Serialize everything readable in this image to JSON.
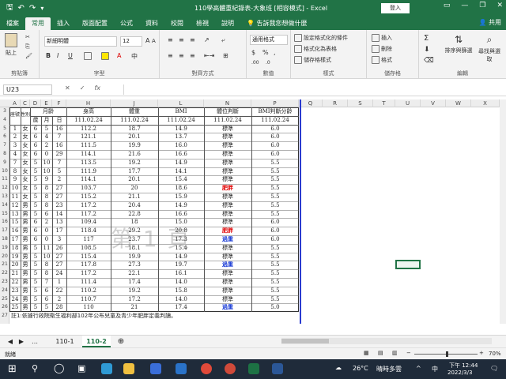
{
  "window": {
    "title": "110學高體重紀錄表-大象班 [相容模式] - Excel",
    "login": "登入"
  },
  "tabs": [
    {
      "label": "檔案"
    },
    {
      "label": "常用",
      "active": true
    },
    {
      "label": "插入"
    },
    {
      "label": "版面配置"
    },
    {
      "label": "公式"
    },
    {
      "label": "資料"
    },
    {
      "label": "校閱"
    },
    {
      "label": "檢視"
    },
    {
      "label": "說明"
    }
  ],
  "tell_me": "告訴我您想做什麼",
  "share": "共用",
  "ribbon": {
    "paste": "貼上",
    "clipboard": "剪貼簿",
    "font_name": "新細明體",
    "font_size": "12",
    "font_group": "字型",
    "bold": "B",
    "italic": "I",
    "underline": "U",
    "align_group": "對齊方式",
    "number_format": "通用格式",
    "number_group": "數值",
    "cond_format": "設定格式化的條件",
    "table_format": "格式化為表格",
    "cell_style": "儲存格樣式",
    "styles_group": "樣式",
    "insert": "插入",
    "delete": "刪除",
    "format": "格式",
    "cells_group": "儲存格",
    "sort_filter": "排序與篩選",
    "find_select": "尋找與選取",
    "edit_group": "編輯"
  },
  "formula": {
    "name_box": "U23",
    "cancel": "✕",
    "confirm": "✓",
    "fx": "fx"
  },
  "columns": [
    "A",
    "C",
    "D",
    "E",
    "F",
    "H",
    "J",
    "L",
    "N",
    "P",
    "Q",
    "R",
    "S",
    "T",
    "U",
    "V",
    "W",
    "X"
  ],
  "header": {
    "seat": "座號",
    "gender": "性別",
    "age": "月齡",
    "age_years": "歲",
    "age_month": "月",
    "age_day": "日",
    "height": "身高",
    "weight": "體重",
    "bmi": "BMI",
    "status": "體位判斷",
    "bmi_ref": "BMI判斷分齡",
    "date": "111.02.24"
  },
  "rows": [
    {
      "r": "5",
      "seat": "1",
      "g": "女",
      "y": "6",
      "m": "5",
      "d": "16",
      "h": "112.2",
      "w": "18.7",
      "b": "14.9",
      "s": "標準",
      "p": "6.0"
    },
    {
      "r": "6",
      "seat": "2",
      "g": "女",
      "y": "6",
      "m": "4",
      "d": "7",
      "h": "121.1",
      "w": "20.1",
      "b": "13.7",
      "s": "標準",
      "p": "6.0"
    },
    {
      "r": "7",
      "seat": "3",
      "g": "女",
      "y": "6",
      "m": "2",
      "d": "16",
      "h": "111.5",
      "w": "19.9",
      "b": "16.0",
      "s": "標準",
      "p": "6.0"
    },
    {
      "r": "8",
      "seat": "4",
      "g": "女",
      "y": "6",
      "m": "0",
      "d": "29",
      "h": "114.1",
      "w": "21.6",
      "b": "16.6",
      "s": "標準",
      "p": "6.0"
    },
    {
      "r": "9",
      "seat": "7",
      "g": "女",
      "y": "5",
      "m": "10",
      "d": "7",
      "h": "113.5",
      "w": "19.2",
      "b": "14.9",
      "s": "標準",
      "p": "5.5"
    },
    {
      "r": "10",
      "seat": "8",
      "g": "女",
      "y": "5",
      "m": "10",
      "d": "5",
      "h": "111.9",
      "w": "17.7",
      "b": "14.1",
      "s": "標準",
      "p": "5.5"
    },
    {
      "r": "11",
      "seat": "9",
      "g": "女",
      "y": "5",
      "m": "9",
      "d": "2",
      "h": "114.1",
      "w": "20.1",
      "b": "15.4",
      "s": "標準",
      "p": "5.5"
    },
    {
      "r": "12",
      "seat": "10",
      "g": "女",
      "y": "5",
      "m": "8",
      "d": "27",
      "h": "103.7",
      "w": "20",
      "b": "18.6",
      "s": "肥胖",
      "p": "5.5",
      "red": true
    },
    {
      "r": "13",
      "seat": "11",
      "g": "女",
      "y": "5",
      "m": "8",
      "d": "27",
      "h": "115.2",
      "w": "21.1",
      "b": "15.9",
      "s": "標準",
      "p": "5.5"
    },
    {
      "r": "14",
      "seat": "12",
      "g": "男",
      "y": "5",
      "m": "8",
      "d": "23",
      "h": "117.2",
      "w": "20.4",
      "b": "14.9",
      "s": "標準",
      "p": "5.5"
    },
    {
      "r": "15",
      "seat": "13",
      "g": "男",
      "y": "5",
      "m": "6",
      "d": "14",
      "h": "117.2",
      "w": "22.8",
      "b": "16.6",
      "s": "標準",
      "p": "5.5"
    },
    {
      "r": "16",
      "seat": "15",
      "g": "男",
      "y": "6",
      "m": "2",
      "d": "13",
      "h": "109.4",
      "w": "18",
      "b": "15.0",
      "s": "標準",
      "p": "6.0"
    },
    {
      "r": "17",
      "seat": "16",
      "g": "男",
      "y": "6",
      "m": "0",
      "d": "17",
      "h": "118.4",
      "w": "29.2",
      "b": "20.8",
      "s": "肥胖",
      "p": "6.0",
      "red": true
    },
    {
      "r": "18",
      "seat": "17",
      "g": "男",
      "y": "6",
      "m": "0",
      "d": "3",
      "h": "117",
      "w": "23.7",
      "b": "17.3",
      "s": "過重",
      "p": "6.0",
      "blue": true
    },
    {
      "r": "19",
      "seat": "18",
      "g": "男",
      "y": "5",
      "m": "11",
      "d": "26",
      "h": "108.5",
      "w": "18.1",
      "b": "15.4",
      "s": "標準",
      "p": "5.5"
    },
    {
      "r": "20",
      "seat": "19",
      "g": "男",
      "y": "5",
      "m": "10",
      "d": "27",
      "h": "115.4",
      "w": "19.9",
      "b": "14.9",
      "s": "標準",
      "p": "5.5"
    },
    {
      "r": "21",
      "seat": "20",
      "g": "男",
      "y": "5",
      "m": "8",
      "d": "27",
      "h": "117.8",
      "w": "27.3",
      "b": "19.7",
      "s": "過重",
      "p": "5.5",
      "blue": true
    },
    {
      "r": "22",
      "seat": "21",
      "g": "男",
      "y": "5",
      "m": "8",
      "d": "24",
      "h": "117.2",
      "w": "22.1",
      "b": "16.1",
      "s": "標準",
      "p": "5.5"
    },
    {
      "r": "23",
      "seat": "22",
      "g": "男",
      "y": "5",
      "m": "7",
      "d": "1",
      "h": "111.4",
      "w": "17.4",
      "b": "14.0",
      "s": "標準",
      "p": "5.5"
    },
    {
      "r": "24",
      "seat": "23",
      "g": "男",
      "y": "5",
      "m": "6",
      "d": "22",
      "h": "110.2",
      "w": "19.2",
      "b": "15.8",
      "s": "標準",
      "p": "5.5"
    },
    {
      "r": "25",
      "seat": "24",
      "g": "男",
      "y": "5",
      "m": "6",
      "d": "2",
      "h": "110.7",
      "w": "17.2",
      "b": "14.0",
      "s": "標準",
      "p": "5.5"
    },
    {
      "r": "26",
      "seat": "25",
      "g": "男",
      "y": "5",
      "m": "5",
      "d": "28",
      "h": "110",
      "w": "21",
      "b": "17.4",
      "s": "過重",
      "p": "5.0",
      "blue": true
    }
  ],
  "footnote": "註1:依據行政院衛生福利部102年公布兒童及青少年肥胖定義判讀。",
  "watermark": "第 1 頁",
  "header_rows": {
    "r3": "3",
    "r4": "4"
  },
  "last_row": "27",
  "sheets": [
    {
      "label": "110-1"
    },
    {
      "label": "110-2",
      "active": true
    }
  ],
  "status": {
    "ready": "就緒",
    "zoom": "70%"
  },
  "taskbar": {
    "temp": "26°C",
    "weather": "晴時多雲",
    "lang": "中",
    "time": "下午 12:44",
    "date": "2022/3/3"
  },
  "colors": {
    "excel_green": "#217346",
    "red": "#e00000",
    "blue": "#1b3dd6"
  }
}
